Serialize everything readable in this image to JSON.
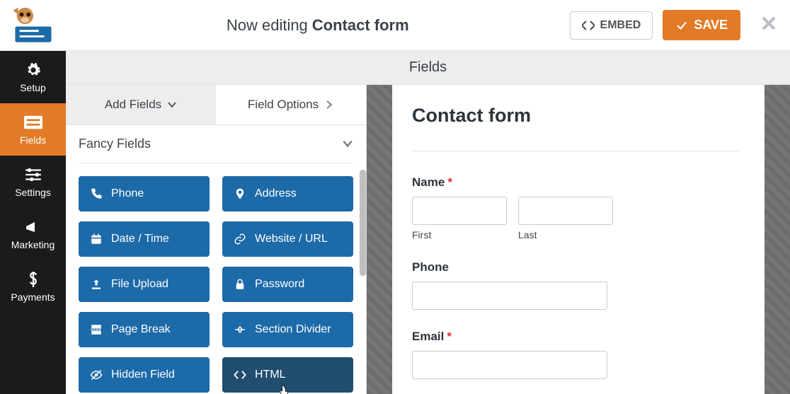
{
  "header": {
    "editing_prefix": "Now editing",
    "form_name": "Contact form",
    "embed_label": "EMBED",
    "save_label": "SAVE"
  },
  "rail": [
    {
      "key": "setup",
      "label": "Setup"
    },
    {
      "key": "fields",
      "label": "Fields"
    },
    {
      "key": "settings",
      "label": "Settings"
    },
    {
      "key": "marketing",
      "label": "Marketing"
    },
    {
      "key": "payments",
      "label": "Payments"
    }
  ],
  "page_heading": "Fields",
  "fields_panel": {
    "tab_add": "Add Fields",
    "tab_options": "Field Options",
    "section_title": "Fancy Fields",
    "items": [
      {
        "icon": "phone",
        "label": "Phone"
      },
      {
        "icon": "pin",
        "label": "Address"
      },
      {
        "icon": "calendar",
        "label": "Date / Time"
      },
      {
        "icon": "link",
        "label": "Website / URL"
      },
      {
        "icon": "upload",
        "label": "File Upload"
      },
      {
        "icon": "lock",
        "label": "Password"
      },
      {
        "icon": "pagebreak",
        "label": "Page Break"
      },
      {
        "icon": "divider",
        "label": "Section Divider"
      },
      {
        "icon": "eye-off",
        "label": "Hidden Field"
      },
      {
        "icon": "code",
        "label": "HTML"
      }
    ],
    "hovered_index": 9
  },
  "preview": {
    "title": "Contact form",
    "name_label": "Name",
    "name_required": true,
    "first_label": "First",
    "last_label": "Last",
    "phone_label": "Phone",
    "email_label": "Email",
    "email_required": true
  },
  "colors": {
    "accent": "#e27a26",
    "blue": "#1d6aa8",
    "bluehover": "#214d6f"
  }
}
